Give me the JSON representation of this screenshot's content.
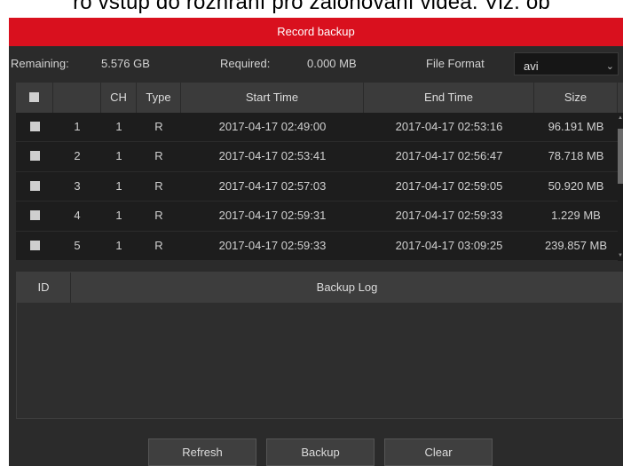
{
  "caption": "ro vstup do rozhraní pro zálohování videa. Viz. ob",
  "window": {
    "title": "Record backup"
  },
  "info": {
    "remaining_label": "Remaining:",
    "remaining_value": "5.576 GB",
    "required_label": "Required:",
    "required_value": "0.000 MB",
    "format_label": "File Format",
    "format_value": "avi"
  },
  "table": {
    "columns": [
      "",
      "CH",
      "Type",
      "Start Time",
      "End Time",
      "Size"
    ],
    "rows": [
      {
        "id": "1",
        "ch": "1",
        "type": "R",
        "start": "2017-04-17 02:49:00",
        "end": "2017-04-17 02:53:16",
        "size": "96.191 MB"
      },
      {
        "id": "2",
        "ch": "1",
        "type": "R",
        "start": "2017-04-17 02:53:41",
        "end": "2017-04-17 02:56:47",
        "size": "78.718 MB"
      },
      {
        "id": "3",
        "ch": "1",
        "type": "R",
        "start": "2017-04-17 02:57:03",
        "end": "2017-04-17 02:59:05",
        "size": "50.920 MB"
      },
      {
        "id": "4",
        "ch": "1",
        "type": "R",
        "start": "2017-04-17 02:59:31",
        "end": "2017-04-17 02:59:33",
        "size": "1.229 MB"
      },
      {
        "id": "5",
        "ch": "1",
        "type": "R",
        "start": "2017-04-17 02:59:33",
        "end": "2017-04-17 03:09:25",
        "size": "239.857 MB"
      }
    ]
  },
  "log": {
    "id_header": "ID",
    "log_header": "Backup Log"
  },
  "buttons": {
    "refresh": "Refresh",
    "backup": "Backup",
    "clear": "Clear"
  },
  "colors": {
    "title_bar": "#d9101e",
    "panel": "#2b2b2b"
  },
  "icons": {
    "select_arrow": "chevron-down-icon",
    "checkbox": "checkbox-icon"
  }
}
